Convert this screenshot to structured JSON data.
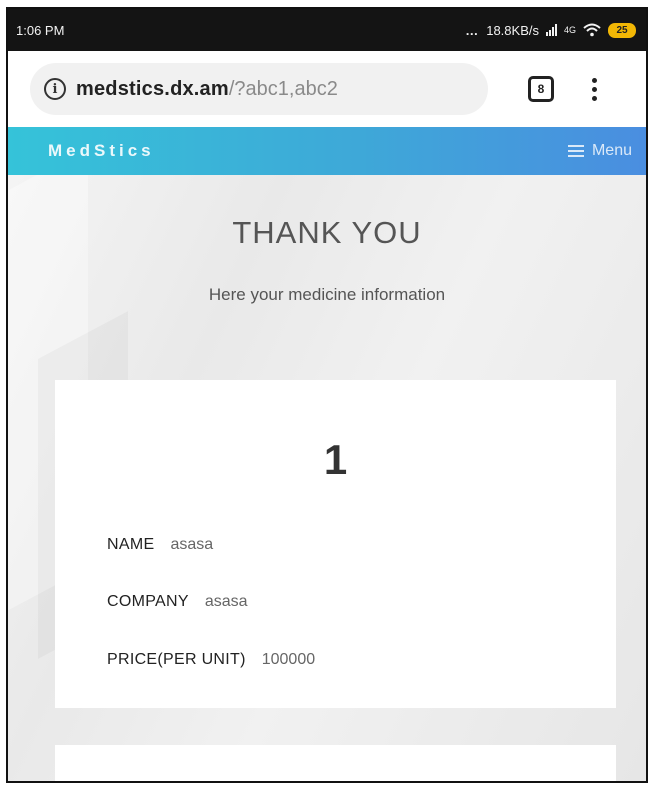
{
  "status_bar": {
    "time": "1:06 PM",
    "network_speed": "18.8KB/s",
    "network_type": "4G",
    "battery": "25",
    "icons": [
      "signal-icon",
      "wifi-icon",
      "battery-icon"
    ]
  },
  "browser": {
    "url_host": "medstics.dx.am",
    "url_path": "/?abc1,abc2",
    "tab_count": "8",
    "icons": [
      "info-icon",
      "tabs-icon",
      "kebab-menu-icon"
    ]
  },
  "site_nav": {
    "brand": "MedStics",
    "menu_label": "Menu",
    "gradient": [
      "#35c3d9",
      "#4a8ee0"
    ]
  },
  "page": {
    "title": "THANK YOU",
    "subtitle": "Here your medicine information"
  },
  "cards": [
    {
      "number": "1",
      "fields": [
        {
          "label": "NAME",
          "value": "asasa"
        },
        {
          "label": "COMPANY",
          "value": "asasa"
        },
        {
          "label": "PRICE(PER UNIT)",
          "value": "100000"
        }
      ]
    }
  ]
}
